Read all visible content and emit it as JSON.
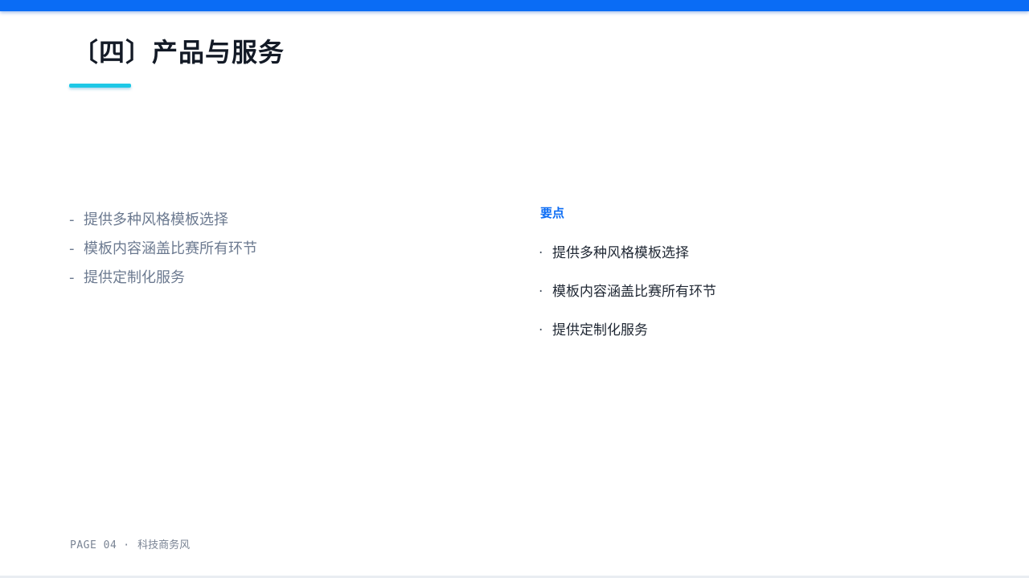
{
  "slide": {
    "title": "〔四〕产品与服务",
    "accent_color": "#0a6cf5",
    "underline_color": "#1ec8e6"
  },
  "left_list": {
    "marker": "-",
    "items": [
      "提供多种风格模板选择",
      "模板内容涵盖比赛所有环节",
      "提供定制化服务"
    ]
  },
  "right_panel": {
    "heading": "要点",
    "marker": "·",
    "items": [
      "提供多种风格模板选择",
      "模板内容涵盖比赛所有环节",
      "提供定制化服务"
    ]
  },
  "footer": {
    "page_label": "PAGE 04",
    "separator": "·",
    "theme_label": "科技商务风"
  }
}
